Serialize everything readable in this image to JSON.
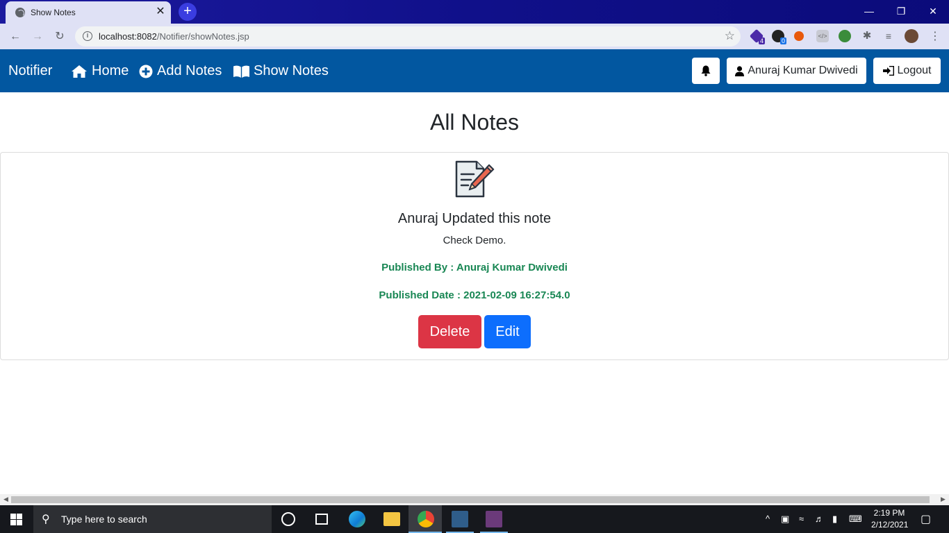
{
  "browser": {
    "tab_title": "Show Notes",
    "url_host": "localhost:8082",
    "url_path": "/Notifier/showNotes.jsp",
    "extension_badges": [
      "4",
      "0"
    ]
  },
  "navbar": {
    "brand": "Notifier",
    "links": [
      {
        "label": "Home",
        "icon": "home-icon"
      },
      {
        "label": "Add Notes",
        "icon": "plus-circle-icon"
      },
      {
        "label": "Show Notes",
        "icon": "book-icon"
      }
    ],
    "user_label": "Anuraj Kumar Dwivedi",
    "logout_label": "Logout"
  },
  "page": {
    "title": "All Notes"
  },
  "note": {
    "title": "Anuraj Updated this note",
    "content": "Check Demo.",
    "published_by": "Published By : Anuraj Kumar Dwivedi",
    "published_date": "Published Date : 2021-02-09 16:27:54.0",
    "delete_label": "Delete",
    "edit_label": "Edit"
  },
  "taskbar": {
    "search_placeholder": "Type here to search",
    "time": "2:19 PM",
    "date": "2/12/2021"
  },
  "colors": {
    "navbar": "#0257a0",
    "delete": "#dc3545",
    "edit": "#0d6efd",
    "meta_text": "#198754"
  }
}
